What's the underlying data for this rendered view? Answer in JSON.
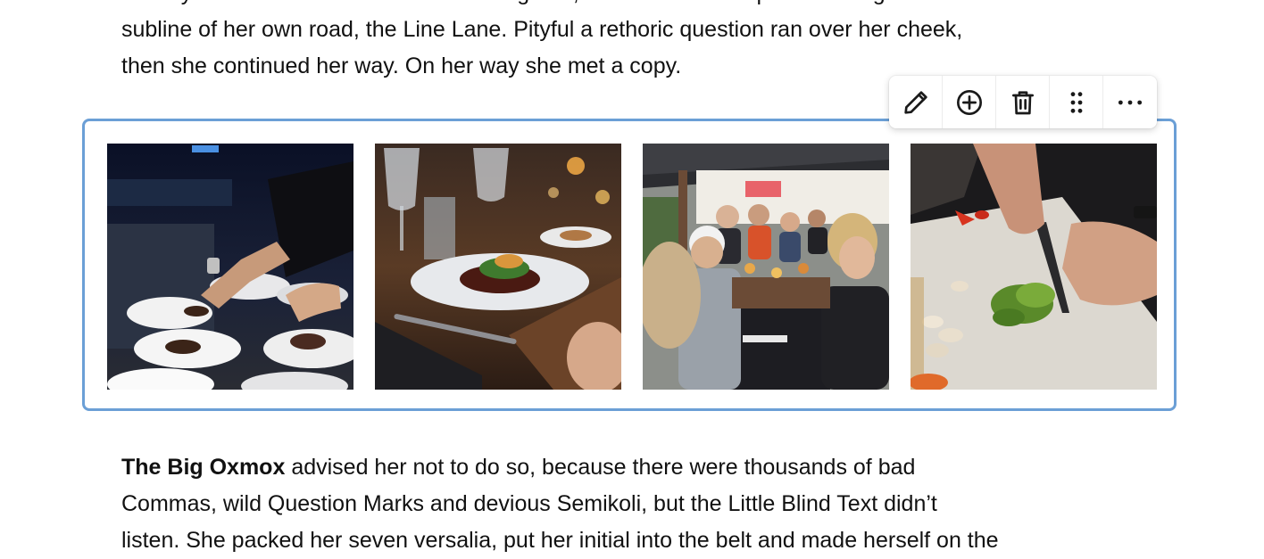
{
  "paragraph_top": {
    "lines": [
      "the skyline of her hometown Bookmarksgrove, the headline of Alphabet Village and the",
      "subline of her own road, the Line Lane. Pityful a rethoric question ran over her cheek,",
      "then she continued her way. On her way she met a copy."
    ]
  },
  "paragraph_bottom": {
    "bold_lead": "The Big Oxmox",
    "line1_rest": " advised her not to do so, because there were thousands of bad",
    "line2": "Commas, wild Question Marks and devious Semikoli, but the Little Blind Text didn’t",
    "line3": "listen. She packed her seven versalia, put her initial into the belt and made herself on the"
  },
  "toolbar": {
    "buttons": [
      {
        "icon": "pencil-icon",
        "action": "edit"
      },
      {
        "icon": "plus-circle-icon",
        "action": "add"
      },
      {
        "icon": "trash-icon",
        "action": "delete"
      },
      {
        "icon": "drag-handle-icon",
        "action": "move"
      },
      {
        "icon": "more-horizontal-icon",
        "action": "more"
      }
    ]
  },
  "gallery": {
    "images": [
      {
        "subject": "chef plating dishes at a kitchen pass"
      },
      {
        "subject": "plated dish on a restaurant table with wine glasses"
      },
      {
        "subject": "group of friends dining outdoors"
      },
      {
        "subject": "hands chopping vegetables on a cutting board"
      }
    ]
  },
  "colors": {
    "gallery_border": "#6b9fd6",
    "text": "#111111",
    "toolbar_bg": "#ffffff"
  }
}
